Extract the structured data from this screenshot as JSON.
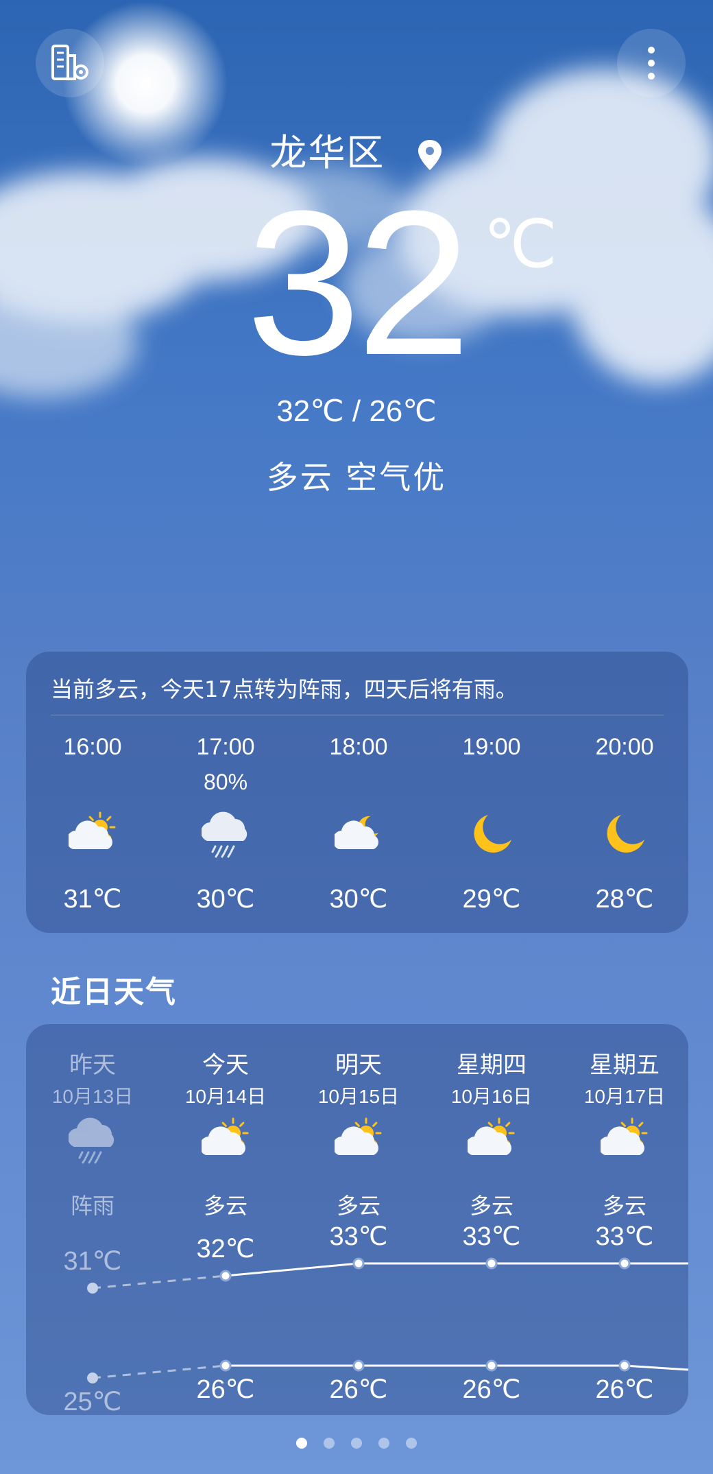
{
  "header": {
    "city": "龙华区",
    "current_temp": "32",
    "unit": "℃",
    "range": "32℃ / 26℃",
    "condition": "多云  空气优"
  },
  "hourly": {
    "summary": "当前多云，今天17点转为阵雨，四天后将有雨。",
    "items": [
      {
        "time": "16:00",
        "precip": "",
        "icon": "partly-cloudy-day-icon",
        "temp": "31℃"
      },
      {
        "time": "17:00",
        "precip": "80%",
        "icon": "rain-cloud-icon",
        "temp": "30℃"
      },
      {
        "time": "18:00",
        "precip": "",
        "icon": "partly-cloudy-night-icon",
        "temp": "30℃"
      },
      {
        "time": "19:00",
        "precip": "",
        "icon": "moon-icon",
        "temp": "29℃"
      },
      {
        "time": "20:00",
        "precip": "",
        "icon": "moon-icon",
        "temp": "28℃"
      }
    ]
  },
  "daily": {
    "title": "近日天气",
    "days": [
      {
        "name": "昨天",
        "date": "10月13日",
        "icon": "rain-cloud-icon",
        "cond": "阵雨",
        "high": "31℃",
        "low": "25℃"
      },
      {
        "name": "今天",
        "date": "10月14日",
        "icon": "partly-cloudy-day-icon",
        "cond": "多云",
        "high": "32℃",
        "low": "26℃"
      },
      {
        "name": "明天",
        "date": "10月15日",
        "icon": "partly-cloudy-day-icon",
        "cond": "多云",
        "high": "33℃",
        "low": "26℃"
      },
      {
        "name": "星期四",
        "date": "10月16日",
        "icon": "partly-cloudy-day-icon",
        "cond": "多云",
        "high": "33℃",
        "low": "26℃"
      },
      {
        "name": "星期五",
        "date": "10月17日",
        "icon": "partly-cloudy-day-icon",
        "cond": "多云",
        "high": "33℃",
        "low": "26℃"
      }
    ]
  },
  "pager": {
    "count": 5,
    "active": 1
  }
}
